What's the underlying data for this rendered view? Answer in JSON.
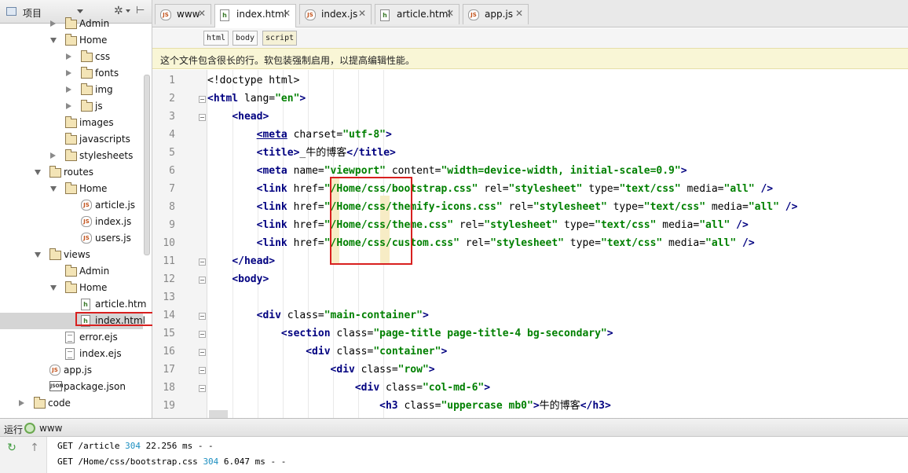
{
  "sidebar": {
    "title": "项目",
    "items": [
      {
        "label": "Admin",
        "type": "folder",
        "depth": 3,
        "state": "closed"
      },
      {
        "label": "Home",
        "type": "folder",
        "depth": 3,
        "state": "open"
      },
      {
        "label": "css",
        "type": "folder",
        "depth": 4,
        "state": "closed"
      },
      {
        "label": "fonts",
        "type": "folder",
        "depth": 4,
        "state": "closed"
      },
      {
        "label": "img",
        "type": "folder",
        "depth": 4,
        "state": "closed"
      },
      {
        "label": "js",
        "type": "folder",
        "depth": 4,
        "state": "closed"
      },
      {
        "label": "images",
        "type": "folder",
        "depth": 3,
        "state": "none"
      },
      {
        "label": "javascripts",
        "type": "folder",
        "depth": 3,
        "state": "none"
      },
      {
        "label": "stylesheets",
        "type": "folder",
        "depth": 3,
        "state": "closed"
      },
      {
        "label": "routes",
        "type": "folder",
        "depth": 2,
        "state": "open"
      },
      {
        "label": "Home",
        "type": "folder",
        "depth": 3,
        "state": "open"
      },
      {
        "label": "article.js",
        "type": "js",
        "depth": 4,
        "state": "none"
      },
      {
        "label": "index.js",
        "type": "js",
        "depth": 4,
        "state": "none"
      },
      {
        "label": "users.js",
        "type": "js",
        "depth": 4,
        "state": "none"
      },
      {
        "label": "views",
        "type": "folder",
        "depth": 2,
        "state": "open"
      },
      {
        "label": "Admin",
        "type": "folder",
        "depth": 3,
        "state": "none"
      },
      {
        "label": "Home",
        "type": "folder",
        "depth": 3,
        "state": "open"
      },
      {
        "label": "article.htm",
        "type": "html",
        "depth": 4,
        "state": "none"
      },
      {
        "label": "index.html",
        "type": "html",
        "depth": 4,
        "state": "none",
        "selected": true
      },
      {
        "label": "error.ejs",
        "type": "ejs",
        "depth": 3,
        "state": "none"
      },
      {
        "label": "index.ejs",
        "type": "ejs",
        "depth": 3,
        "state": "none"
      },
      {
        "label": "app.js",
        "type": "js",
        "depth": 2,
        "state": "none"
      },
      {
        "label": "package.json",
        "type": "json",
        "depth": 2,
        "state": "none"
      },
      {
        "label": "code",
        "type": "folder",
        "depth": 1,
        "state": "closed"
      }
    ]
  },
  "tabs": [
    {
      "label": "www",
      "icon": "js",
      "active": false
    },
    {
      "label": "index.html",
      "icon": "html",
      "active": true
    },
    {
      "label": "index.js",
      "icon": "js",
      "active": false
    },
    {
      "label": "article.html",
      "icon": "html",
      "active": false
    },
    {
      "label": "app.js",
      "icon": "js",
      "active": false
    }
  ],
  "breadcrumb": [
    "html",
    "body",
    "script"
  ],
  "notice": "这个文件包含很长的行。软包装强制启用，以提高编辑性能。",
  "code": [
    [
      [
        "t",
        "<!doctype html>"
      ]
    ],
    [
      [
        "k",
        "<html"
      ],
      [
        "a",
        " lang="
      ],
      [
        "s",
        "\"en\""
      ],
      [
        "k",
        ">"
      ]
    ],
    [
      [
        "t",
        "    "
      ],
      [
        "k",
        "<head>"
      ]
    ],
    [
      [
        "t",
        "        "
      ],
      [
        "ku",
        "<meta"
      ],
      [
        "a",
        " charset="
      ],
      [
        "s",
        "\"utf-8\""
      ],
      [
        "k",
        ">"
      ]
    ],
    [
      [
        "t",
        "        "
      ],
      [
        "k",
        "<title>"
      ],
      [
        "t",
        "_牛的博客"
      ],
      [
        "k",
        "</title>"
      ]
    ],
    [
      [
        "t",
        "        "
      ],
      [
        "k",
        "<meta"
      ],
      [
        "a",
        " name="
      ],
      [
        "s",
        "\"viewport\""
      ],
      [
        "a",
        " content="
      ],
      [
        "s",
        "\"width=device-width, initial-scale=0.9\""
      ],
      [
        "k",
        ">"
      ]
    ],
    [
      [
        "t",
        "        "
      ],
      [
        "k",
        "<link"
      ],
      [
        "a",
        " href="
      ],
      [
        "s",
        "\"/Home/css/bootstrap.css\""
      ],
      [
        "a",
        " rel="
      ],
      [
        "s",
        "\"stylesheet\""
      ],
      [
        "a",
        " type="
      ],
      [
        "s",
        "\"text/css\""
      ],
      [
        "a",
        " media="
      ],
      [
        "s",
        "\"all\""
      ],
      [
        "k",
        " />"
      ]
    ],
    [
      [
        "t",
        "        "
      ],
      [
        "k",
        "<link"
      ],
      [
        "a",
        " href="
      ],
      [
        "s",
        "\"/Home/css/themify-icons.css\""
      ],
      [
        "a",
        " rel="
      ],
      [
        "s",
        "\"stylesheet\""
      ],
      [
        "a",
        " type="
      ],
      [
        "s",
        "\"text/css\""
      ],
      [
        "a",
        " media="
      ],
      [
        "s",
        "\"all\""
      ],
      [
        "k",
        " />"
      ]
    ],
    [
      [
        "t",
        "        "
      ],
      [
        "k",
        "<link"
      ],
      [
        "a",
        " href="
      ],
      [
        "s",
        "\"/Home/css/theme.css\""
      ],
      [
        "a",
        " rel="
      ],
      [
        "s",
        "\"stylesheet\""
      ],
      [
        "a",
        " type="
      ],
      [
        "s",
        "\"text/css\""
      ],
      [
        "a",
        " media="
      ],
      [
        "s",
        "\"all\""
      ],
      [
        "k",
        " />"
      ]
    ],
    [
      [
        "t",
        "        "
      ],
      [
        "k",
        "<link"
      ],
      [
        "a",
        " href="
      ],
      [
        "s",
        "\"/Home/css/custom.css\""
      ],
      [
        "a",
        " rel="
      ],
      [
        "s",
        "\"stylesheet\""
      ],
      [
        "a",
        " type="
      ],
      [
        "s",
        "\"text/css\""
      ],
      [
        "a",
        " media="
      ],
      [
        "s",
        "\"all\""
      ],
      [
        "k",
        " />"
      ]
    ],
    [
      [
        "t",
        "    "
      ],
      [
        "k",
        "</head>"
      ]
    ],
    [
      [
        "t",
        "    "
      ],
      [
        "k",
        "<body>"
      ]
    ],
    [
      [
        "t",
        ""
      ]
    ],
    [
      [
        "t",
        "        "
      ],
      [
        "k",
        "<div"
      ],
      [
        "a",
        " class="
      ],
      [
        "s",
        "\"main-container\""
      ],
      [
        "k",
        ">"
      ]
    ],
    [
      [
        "t",
        "            "
      ],
      [
        "k",
        "<section"
      ],
      [
        "a",
        " class="
      ],
      [
        "s",
        "\"page-title page-title-4 bg-secondary\""
      ],
      [
        "k",
        ">"
      ]
    ],
    [
      [
        "t",
        "                "
      ],
      [
        "k",
        "<div"
      ],
      [
        "a",
        " class="
      ],
      [
        "s",
        "\"container\""
      ],
      [
        "k",
        ">"
      ]
    ],
    [
      [
        "t",
        "                    "
      ],
      [
        "k",
        "<div"
      ],
      [
        "a",
        " class="
      ],
      [
        "s",
        "\"row\""
      ],
      [
        "k",
        ">"
      ]
    ],
    [
      [
        "t",
        "                        "
      ],
      [
        "k",
        "<div"
      ],
      [
        "a",
        " class="
      ],
      [
        "s",
        "\"col-md-6\""
      ],
      [
        "k",
        ">"
      ]
    ],
    [
      [
        "t",
        "                            "
      ],
      [
        "k",
        "<h3"
      ],
      [
        "a",
        " class="
      ],
      [
        "s",
        "\"uppercase mb0\""
      ],
      [
        "k",
        ">"
      ],
      [
        "t",
        "牛的博客"
      ],
      [
        "k",
        "</h3>"
      ]
    ]
  ],
  "line_numbers": [
    "1",
    "2",
    "3",
    "4",
    "5",
    "6",
    "7",
    "8",
    "9",
    "10",
    "11",
    "12",
    "13",
    "14",
    "15",
    "16",
    "17",
    "18",
    "19"
  ],
  "run": {
    "label": "运行",
    "config": "www",
    "log": [
      {
        "text": "GET /article ",
        "status": "304",
        "rest": " 22.256 ms - -"
      },
      {
        "text": "GET /Home/css/bootstrap.css ",
        "status": "304",
        "rest": " 6.047 ms - -"
      }
    ]
  },
  "colors": {
    "tag": "#000080",
    "string": "#008000",
    "highlight_box": "#d8201f",
    "notice_bg": "#f9f6d6",
    "status_code": "#1d8fc0"
  }
}
